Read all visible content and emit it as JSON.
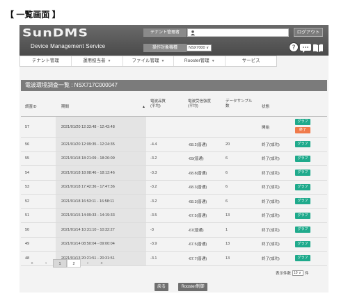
{
  "page_title": "【 一覧画面 】",
  "header": {
    "logo": "SunDMS",
    "subtitle": "Device Management Service",
    "tenant_label": "テナント管理者",
    "device_label": "操作対象機種",
    "device_value": "NSX7000 ∨",
    "logout": "ログアウト"
  },
  "nav": [
    {
      "label": "テナント管理",
      "has_caret": false
    },
    {
      "label": "運用担当者",
      "has_caret": true
    },
    {
      "label": "ファイル管理",
      "has_caret": true
    },
    {
      "label": "Rooster管理",
      "has_caret": true
    },
    {
      "label": "サービス",
      "has_caret": false
    }
  ],
  "panel_title": "電波環境調査一覧 : NSX717C000047",
  "table": {
    "headers": {
      "id": "調査ID",
      "period": "期間",
      "avg_strength": "電波品質\n(平均)",
      "avg_rssi": "電波受信強度\n(平均)",
      "samples": "データサンプル\n数",
      "status": "状態"
    },
    "rows": [
      {
        "id": "57",
        "period": "2021/01/20 12:33:48 - 12:43:48",
        "strength": "",
        "rssi": "",
        "samples": "",
        "status": "開始",
        "buttons": [
          "グラフ",
          "終了"
        ]
      },
      {
        "id": "56",
        "period": "2021/01/20 12:09:35 - 12:24:35",
        "strength": "-4.4",
        "rssi": "-68.2(普通)",
        "samples": "20",
        "status": "終了(成功)",
        "buttons": [
          "グラフ"
        ]
      },
      {
        "id": "55",
        "period": "2021/01/18 18:21:09 - 18:26:09",
        "strength": "-3.2",
        "rssi": "-69(普通)",
        "samples": "6",
        "status": "終了(成功)",
        "buttons": [
          "グラフ"
        ]
      },
      {
        "id": "54",
        "period": "2021/01/18 18:08:46 - 18:13:46",
        "strength": "-3.3",
        "rssi": "-68.8(普通)",
        "samples": "6",
        "status": "終了(成功)",
        "buttons": [
          "グラフ"
        ]
      },
      {
        "id": "53",
        "period": "2021/01/18 17:42:36 - 17:47:36",
        "strength": "-3.2",
        "rssi": "-68.3(普通)",
        "samples": "6",
        "status": "終了(成功)",
        "buttons": [
          "グラフ"
        ]
      },
      {
        "id": "52",
        "period": "2021/01/18 16:53:11 - 16:58:11",
        "strength": "-3.2",
        "rssi": "-68.3(普通)",
        "samples": "6",
        "status": "終了(成功)",
        "buttons": [
          "グラフ"
        ]
      },
      {
        "id": "51",
        "period": "2021/01/15 14:09:33 - 14:19:33",
        "strength": "-3.5",
        "rssi": "-67.5(普通)",
        "samples": "13",
        "status": "終了(成功)",
        "buttons": [
          "グラフ"
        ]
      },
      {
        "id": "50",
        "period": "2021/01/14 10:31:10 - 10:32:27",
        "strength": "-3",
        "rssi": "-67(普通)",
        "samples": "1",
        "status": "終了(成功)",
        "buttons": [
          "グラフ"
        ]
      },
      {
        "id": "49",
        "period": "2021/01/14 08:50:04 - 09:00:04",
        "strength": "-3.9",
        "rssi": "-67.5(普通)",
        "samples": "13",
        "status": "終了(成功)",
        "buttons": [
          "グラフ"
        ]
      },
      {
        "id": "48",
        "period": "2021/01/13 20:21:51 - 20:31:51",
        "strength": "-3.1",
        "rssi": "-67.7(普通)",
        "samples": "13",
        "status": "終了(成功)",
        "buttons": [
          "グラフ"
        ]
      }
    ]
  },
  "pagination": {
    "first": "«",
    "prev": "‹",
    "pages": [
      "1",
      "2"
    ],
    "active_page": "1",
    "next": "›",
    "last": "»"
  },
  "per_page": {
    "label": "表示件数",
    "value": "10",
    "suffix": "件"
  },
  "footer": {
    "back": "戻る",
    "rooster_control": "Rooster制御"
  },
  "colors": {
    "graph_button": "#1faa8c",
    "stop_button": "#f07a4a",
    "header_bg": "#555555"
  }
}
